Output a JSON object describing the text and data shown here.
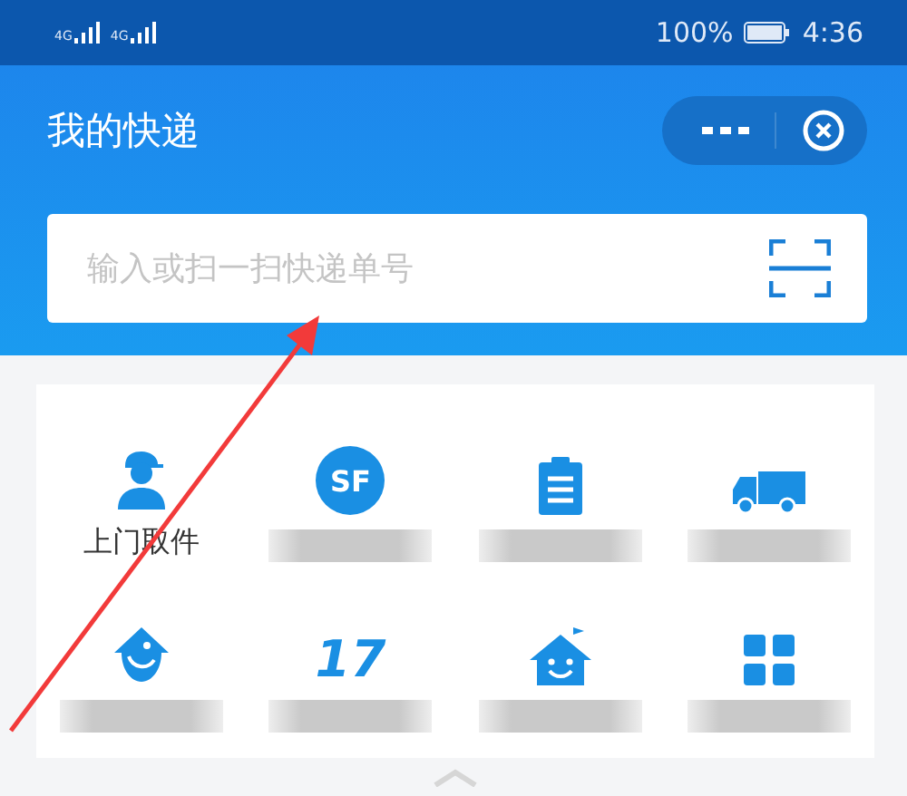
{
  "status_bar": {
    "battery": "100%",
    "time": "4:36",
    "networks": [
      "4G",
      "4G"
    ]
  },
  "header": {
    "title": "我的快递"
  },
  "search": {
    "placeholder": "输入或扫一扫快递单号"
  },
  "services": [
    {
      "kind": "courier",
      "label": "上门取件",
      "blurred": false
    },
    {
      "kind": "logo-circle",
      "logo_text": "SF",
      "blurred": true
    },
    {
      "kind": "clipboard",
      "blurred": true
    },
    {
      "kind": "truck",
      "blurred": true
    },
    {
      "kind": "bird",
      "blurred": true
    },
    {
      "kind": "logo-text",
      "logo_text": "17",
      "blurred": true
    },
    {
      "kind": "house",
      "blurred": true
    },
    {
      "kind": "grid",
      "blurred": true
    }
  ]
}
